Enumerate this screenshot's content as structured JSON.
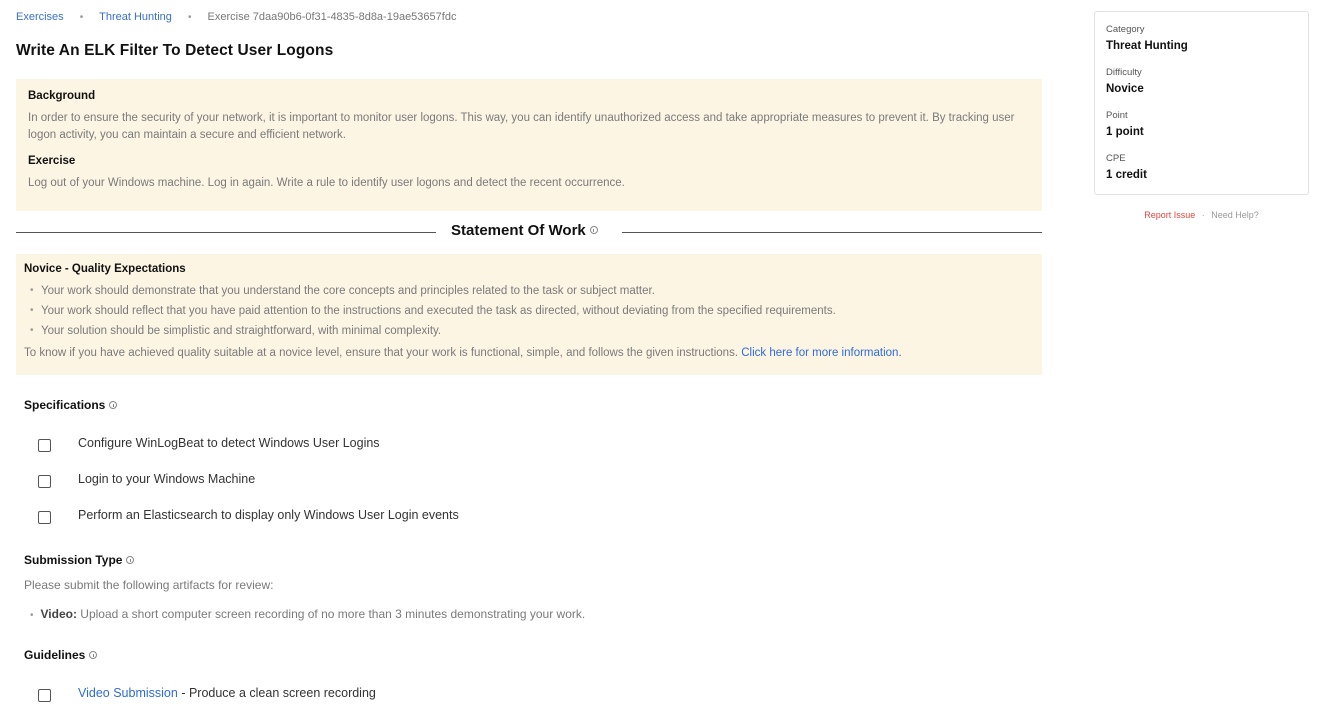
{
  "breadcrumb": {
    "items": [
      "Exercises",
      "Threat Hunting"
    ],
    "current": "Exercise 7daa90b6-0f31-4835-8d8a-19ae53657fdc"
  },
  "page_title": "Write An ELK Filter To Detect User Logons",
  "background": {
    "heading": "Background",
    "text": "In order to ensure the security of your network, it is important to monitor user logons. This way, you can identify unauthorized access and take appropriate measures to prevent it. By tracking user logon activity, you can maintain a secure and efficient network.",
    "exercise_heading": "Exercise",
    "exercise_text": "Log out of your Windows machine. Log in again. Write a rule to identify user logons and detect the recent occurrence."
  },
  "statement_of_work": {
    "title": "Statement Of Work",
    "info_icon": "info-icon"
  },
  "quality": {
    "heading": "Novice - Quality Expectations",
    "bullets": [
      "Your work should demonstrate that you understand the core concepts and principles related to the task or subject matter.",
      "Your work should reflect that you have paid attention to the instructions and executed the task as directed, without deviating from the specified requirements.",
      "Your solution should be simplistic and straightforward, with minimal complexity."
    ],
    "note": "To know if you have achieved quality suitable at a novice level, ensure that your work is functional, simple, and follows the given instructions. ",
    "note_link": "Click here for more information."
  },
  "specifications": {
    "heading": "Specifications",
    "items": [
      {
        "label": "Configure WinLogBeat to detect Windows User Logins",
        "checked": false
      },
      {
        "label": "Login to your Windows Machine",
        "checked": false
      },
      {
        "label": "Perform an Elasticsearch to display only Windows User Login events",
        "checked": false
      }
    ]
  },
  "submission_type": {
    "heading": "Submission Type",
    "intro": "Please submit the following artifacts for review:",
    "items": [
      {
        "label": "Video:",
        "text": " Upload a short computer screen recording of no more than 3 minutes demonstrating your work."
      }
    ]
  },
  "guidelines": {
    "heading": "Guidelines",
    "items": [
      {
        "link": "Video Submission",
        "text": " - Produce a clean screen recording",
        "checked": false
      }
    ]
  },
  "sidebar": {
    "fields": [
      {
        "label": "Category",
        "value": "Threat Hunting"
      },
      {
        "label": "Difficulty",
        "value": "Novice"
      },
      {
        "label": "Point",
        "value": "1 point"
      },
      {
        "label": "CPE",
        "value": "1 credit"
      }
    ],
    "report_issue": "Report Issue",
    "separator": "·",
    "need_help": "Need Help?"
  },
  "colors": {
    "link": "#2f6bd8",
    "panel_bg": "#fdf5e4",
    "report_issue": "#e8463f"
  }
}
